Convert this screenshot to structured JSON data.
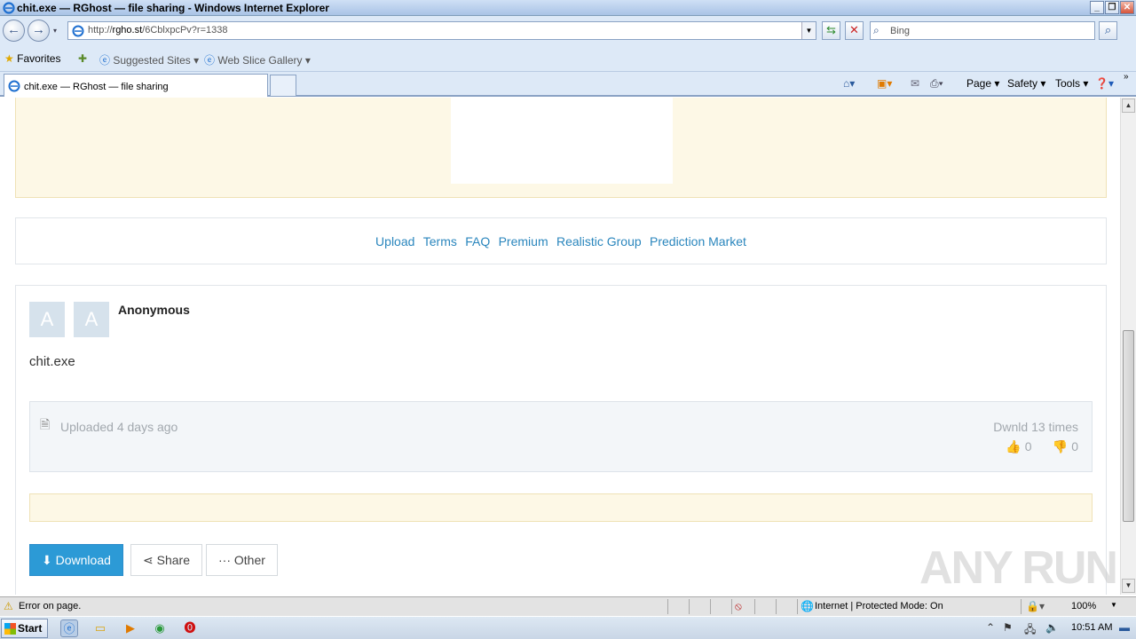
{
  "window": {
    "title": "chit.exe — RGhost — file sharing - Windows Internet Explorer",
    "controls": [
      "_",
      "❐",
      "✕"
    ]
  },
  "address": {
    "url_prefix": "http://",
    "url_host": "rgho.st",
    "url_path": "/6CblxpcPv?r=1338",
    "search_placeholder": "Bing"
  },
  "favorites": {
    "favorites_label": "Favorites",
    "suggested_sites": "Suggested Sites ▾",
    "web_slice_gallery": "Web Slice Gallery ▾"
  },
  "tab": {
    "title": "chit.exe — RGhost — file sharing"
  },
  "command_bar": {
    "page": "Page ▾",
    "safety": "Safety ▾",
    "tools": "Tools ▾"
  },
  "page": {
    "footer_links": [
      "Upload",
      "Terms",
      "FAQ",
      "Premium",
      "Realistic Group",
      "Prediction Market"
    ],
    "avatars": [
      "A",
      "A"
    ],
    "uploader": "Anonymous",
    "filename": "chit.exe",
    "uploaded": "Uploaded 4 days ago",
    "downloads": "Dwnld 13 times",
    "likes": "0",
    "dislikes": "0",
    "buttons": {
      "download": "Download",
      "share": "Share",
      "other": "Other"
    },
    "watermark": "ANY RUN"
  },
  "statusbar": {
    "message": "Error on page.",
    "zone": "Internet | Protected Mode: On",
    "zoom": "100%"
  },
  "taskbar": {
    "start": "Start",
    "clock": "10:51 AM"
  },
  "colors": {
    "link": "#2a86bd",
    "primary_button": "#2c9ad6",
    "ad_background": "#fdf8e6",
    "avatar_background": "#d6e2ec"
  }
}
